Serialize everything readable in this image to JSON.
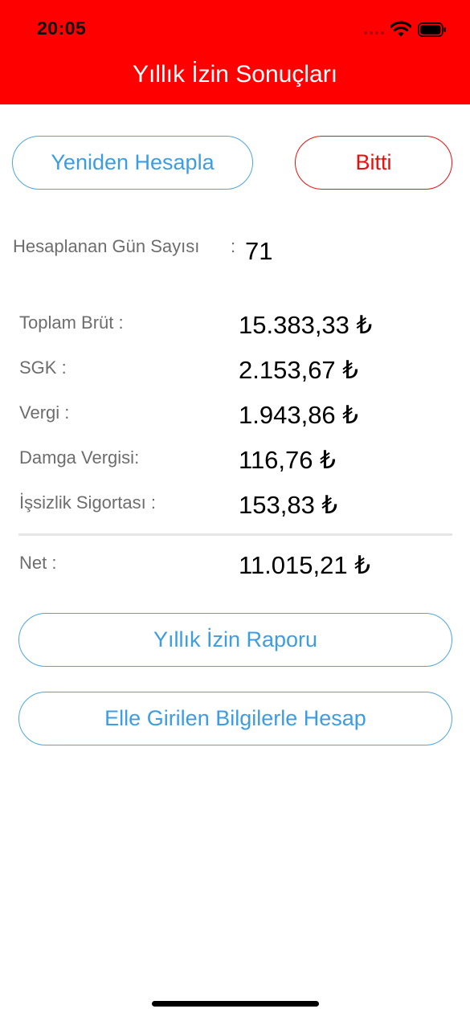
{
  "status_bar": {
    "time": "20:05",
    "icons": [
      "signal-dots-icon",
      "wifi-icon",
      "battery-icon"
    ]
  },
  "nav": {
    "title": "Yıllık İzin Sonuçları",
    "background_color": "#ff0000"
  },
  "actions": {
    "recalculate_label": "Yeniden Hesapla",
    "done_label": "Bitti"
  },
  "days": {
    "label": "Hesaplanan Gün Sayısı",
    "colon": ":",
    "value": "71"
  },
  "breakdown": [
    {
      "label": "Toplam Brüt :",
      "value": "15.383,33 ₺"
    },
    {
      "label": "SGK :",
      "value": "2.153,67 ₺"
    },
    {
      "label": "Vergi :",
      "value": "1.943,86 ₺"
    },
    {
      "label": "Damga Vergisi:",
      "value": "116,76 ₺"
    },
    {
      "label": "İşsizlik Sigortası :",
      "value": "153,83 ₺"
    }
  ],
  "net": {
    "label": "Net :",
    "value": "11.015,21 ₺"
  },
  "links": {
    "report_label": "Yıllık İzin Raporu",
    "manual_label": "Elle Girilen Bilgilerle Hesap"
  },
  "colors": {
    "accent_blue": "#3d9de0",
    "accent_red": "#ea0e0e"
  }
}
